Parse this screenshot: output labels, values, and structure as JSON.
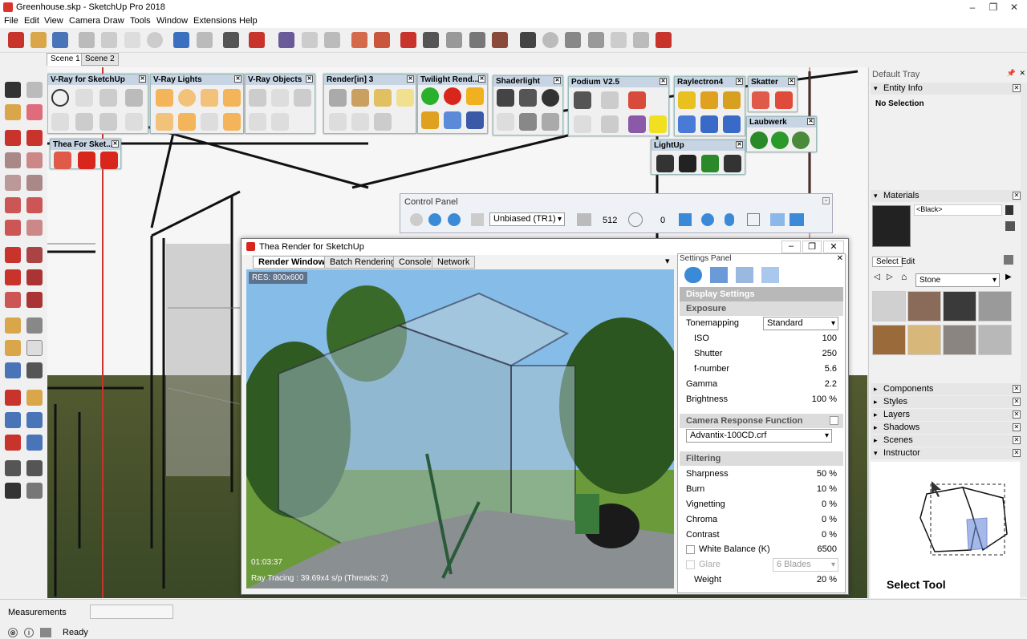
{
  "window": {
    "title": "Greenhouse.skp - SketchUp Pro 2018"
  },
  "menu": [
    "File",
    "Edit",
    "View",
    "Camera",
    "Draw",
    "Tools",
    "Window",
    "Extensions",
    "Help"
  ],
  "scenes": [
    "Scene 1",
    "Scene 2"
  ],
  "panels": {
    "vray": "V-Ray for SketchUp",
    "vraylights": "V-Ray Lights",
    "vrayobjects": "V-Ray Objects",
    "renderin": "Render[in] 3",
    "twilight": "Twilight Rend...",
    "shaderlight": "Shaderlight",
    "podium": "Podium V2.5",
    "raylectron": "Raylectron4",
    "skatter": "Skatter",
    "laubwerk": "Laubwerk",
    "lightup": "LightUp",
    "thea": "Thea For Sket..."
  },
  "control_panel": {
    "title": "Control Panel",
    "mode": "Unbiased (TR1)",
    "samples": "512",
    "time": "0"
  },
  "thea": {
    "title": "Thea Render for SketchUp",
    "tabs": [
      "Render Window",
      "Batch Rendering",
      "Console",
      "Network"
    ],
    "res": "RES: 800x600",
    "elapsed": "01:03:37",
    "status": "Ray Tracing : 39.69x4 s/p (Threads: 2)"
  },
  "settings": {
    "title": "Settings Panel",
    "display": "Display Settings",
    "exposure": "Exposure",
    "tonemapping_label": "Tonemapping",
    "tonemapping": "Standard",
    "iso_label": "ISO",
    "iso": "100",
    "shutter_label": "Shutter",
    "shutter": "250",
    "fnumber_label": "f-number",
    "fnumber": "5.6",
    "gamma_label": "Gamma",
    "gamma": "2.2",
    "brightness_label": "Brightness",
    "brightness": "100 %",
    "crf": "Camera Response Function",
    "crf_file": "Advantix-100CD.crf",
    "filtering": "Filtering",
    "sharpness_label": "Sharpness",
    "sharpness": "50 %",
    "burn_label": "Burn",
    "burn": "10 %",
    "vignetting_label": "Vignetting",
    "vignetting": "0 %",
    "chroma_label": "Chroma",
    "chroma": "0 %",
    "contrast_label": "Contrast",
    "contrast": "0 %",
    "wb_label": "White Balance (K)",
    "wb": "6500",
    "glare_label": "Glare",
    "glare": "6 Blades",
    "weight_label": "Weight",
    "weight": "20 %"
  },
  "tray": {
    "title": "Default Tray",
    "entity": "Entity Info",
    "entity_val": "No Selection",
    "materials": "Materials",
    "material_name": "<Black>",
    "select": "Select",
    "edit": "Edit",
    "library": "Stone",
    "sections": [
      "Components",
      "Styles",
      "Layers",
      "Shadows",
      "Scenes",
      "Instructor"
    ],
    "instructor_caption": "Select Tool"
  },
  "status": {
    "measurements": "Measurements",
    "ready": "Ready"
  },
  "colors": {
    "accent": "#c6d4e4",
    "ground": "#4a5a2e"
  }
}
